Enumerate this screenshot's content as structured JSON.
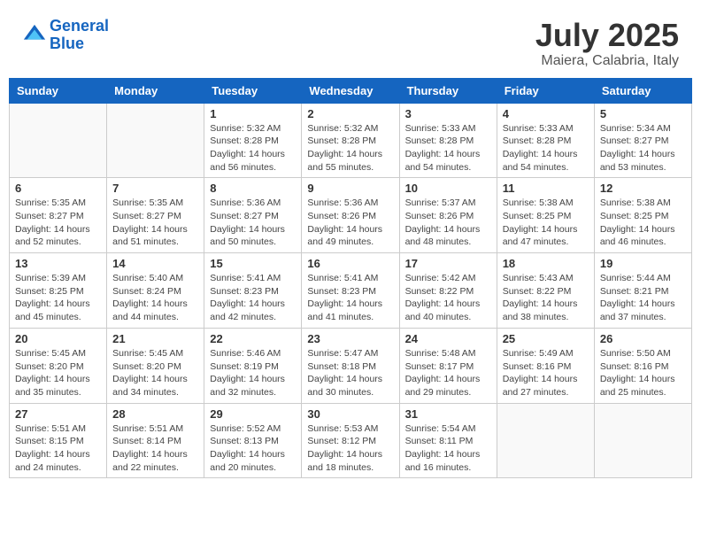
{
  "header": {
    "logo_line1": "General",
    "logo_line2": "Blue",
    "month": "July 2025",
    "location": "Maiera, Calabria, Italy"
  },
  "weekdays": [
    "Sunday",
    "Monday",
    "Tuesday",
    "Wednesday",
    "Thursday",
    "Friday",
    "Saturday"
  ],
  "weeks": [
    [
      {
        "day": "",
        "info": ""
      },
      {
        "day": "",
        "info": ""
      },
      {
        "day": "1",
        "info": "Sunrise: 5:32 AM\nSunset: 8:28 PM\nDaylight: 14 hours and 56 minutes."
      },
      {
        "day": "2",
        "info": "Sunrise: 5:32 AM\nSunset: 8:28 PM\nDaylight: 14 hours and 55 minutes."
      },
      {
        "day": "3",
        "info": "Sunrise: 5:33 AM\nSunset: 8:28 PM\nDaylight: 14 hours and 54 minutes."
      },
      {
        "day": "4",
        "info": "Sunrise: 5:33 AM\nSunset: 8:28 PM\nDaylight: 14 hours and 54 minutes."
      },
      {
        "day": "5",
        "info": "Sunrise: 5:34 AM\nSunset: 8:27 PM\nDaylight: 14 hours and 53 minutes."
      }
    ],
    [
      {
        "day": "6",
        "info": "Sunrise: 5:35 AM\nSunset: 8:27 PM\nDaylight: 14 hours and 52 minutes."
      },
      {
        "day": "7",
        "info": "Sunrise: 5:35 AM\nSunset: 8:27 PM\nDaylight: 14 hours and 51 minutes."
      },
      {
        "day": "8",
        "info": "Sunrise: 5:36 AM\nSunset: 8:27 PM\nDaylight: 14 hours and 50 minutes."
      },
      {
        "day": "9",
        "info": "Sunrise: 5:36 AM\nSunset: 8:26 PM\nDaylight: 14 hours and 49 minutes."
      },
      {
        "day": "10",
        "info": "Sunrise: 5:37 AM\nSunset: 8:26 PM\nDaylight: 14 hours and 48 minutes."
      },
      {
        "day": "11",
        "info": "Sunrise: 5:38 AM\nSunset: 8:25 PM\nDaylight: 14 hours and 47 minutes."
      },
      {
        "day": "12",
        "info": "Sunrise: 5:38 AM\nSunset: 8:25 PM\nDaylight: 14 hours and 46 minutes."
      }
    ],
    [
      {
        "day": "13",
        "info": "Sunrise: 5:39 AM\nSunset: 8:25 PM\nDaylight: 14 hours and 45 minutes."
      },
      {
        "day": "14",
        "info": "Sunrise: 5:40 AM\nSunset: 8:24 PM\nDaylight: 14 hours and 44 minutes."
      },
      {
        "day": "15",
        "info": "Sunrise: 5:41 AM\nSunset: 8:23 PM\nDaylight: 14 hours and 42 minutes."
      },
      {
        "day": "16",
        "info": "Sunrise: 5:41 AM\nSunset: 8:23 PM\nDaylight: 14 hours and 41 minutes."
      },
      {
        "day": "17",
        "info": "Sunrise: 5:42 AM\nSunset: 8:22 PM\nDaylight: 14 hours and 40 minutes."
      },
      {
        "day": "18",
        "info": "Sunrise: 5:43 AM\nSunset: 8:22 PM\nDaylight: 14 hours and 38 minutes."
      },
      {
        "day": "19",
        "info": "Sunrise: 5:44 AM\nSunset: 8:21 PM\nDaylight: 14 hours and 37 minutes."
      }
    ],
    [
      {
        "day": "20",
        "info": "Sunrise: 5:45 AM\nSunset: 8:20 PM\nDaylight: 14 hours and 35 minutes."
      },
      {
        "day": "21",
        "info": "Sunrise: 5:45 AM\nSunset: 8:20 PM\nDaylight: 14 hours and 34 minutes."
      },
      {
        "day": "22",
        "info": "Sunrise: 5:46 AM\nSunset: 8:19 PM\nDaylight: 14 hours and 32 minutes."
      },
      {
        "day": "23",
        "info": "Sunrise: 5:47 AM\nSunset: 8:18 PM\nDaylight: 14 hours and 30 minutes."
      },
      {
        "day": "24",
        "info": "Sunrise: 5:48 AM\nSunset: 8:17 PM\nDaylight: 14 hours and 29 minutes."
      },
      {
        "day": "25",
        "info": "Sunrise: 5:49 AM\nSunset: 8:16 PM\nDaylight: 14 hours and 27 minutes."
      },
      {
        "day": "26",
        "info": "Sunrise: 5:50 AM\nSunset: 8:16 PM\nDaylight: 14 hours and 25 minutes."
      }
    ],
    [
      {
        "day": "27",
        "info": "Sunrise: 5:51 AM\nSunset: 8:15 PM\nDaylight: 14 hours and 24 minutes."
      },
      {
        "day": "28",
        "info": "Sunrise: 5:51 AM\nSunset: 8:14 PM\nDaylight: 14 hours and 22 minutes."
      },
      {
        "day": "29",
        "info": "Sunrise: 5:52 AM\nSunset: 8:13 PM\nDaylight: 14 hours and 20 minutes."
      },
      {
        "day": "30",
        "info": "Sunrise: 5:53 AM\nSunset: 8:12 PM\nDaylight: 14 hours and 18 minutes."
      },
      {
        "day": "31",
        "info": "Sunrise: 5:54 AM\nSunset: 8:11 PM\nDaylight: 14 hours and 16 minutes."
      },
      {
        "day": "",
        "info": ""
      },
      {
        "day": "",
        "info": ""
      }
    ]
  ]
}
